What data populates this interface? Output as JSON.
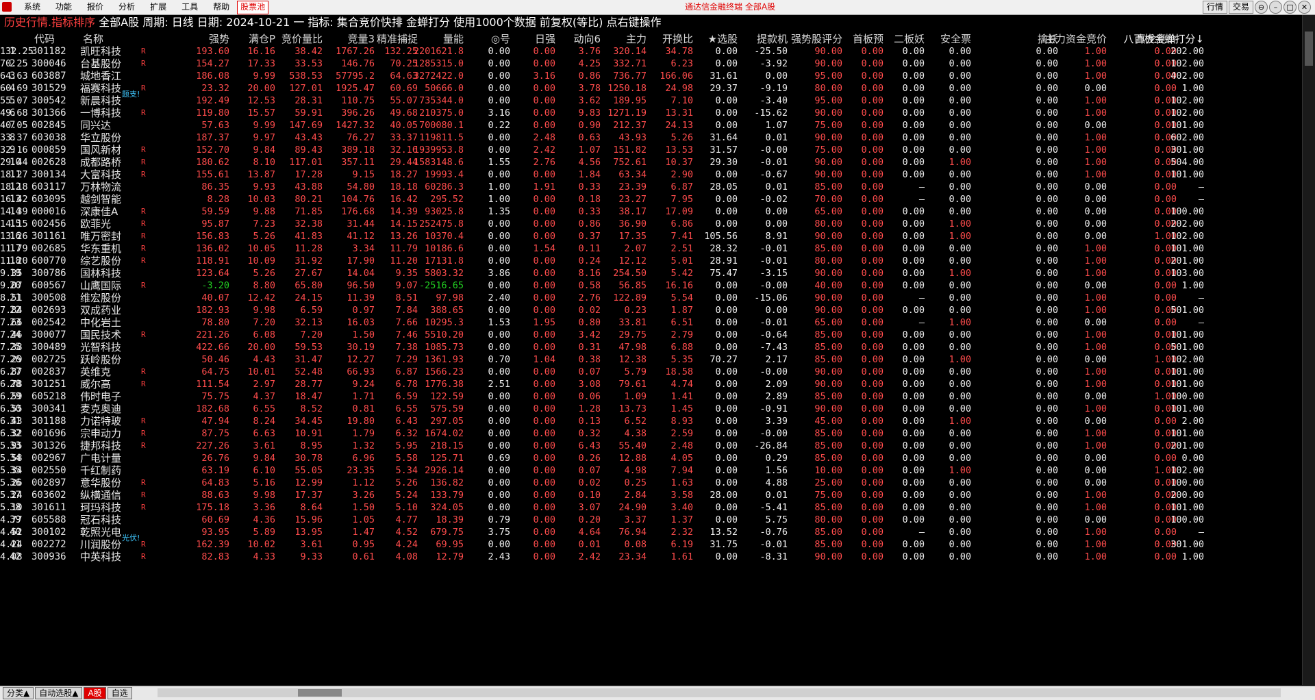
{
  "menubar": {
    "items": [
      "系统",
      "功能",
      "报价",
      "分析",
      "扩展",
      "工具",
      "帮助"
    ],
    "highlight": "股票池",
    "center": "通达信金融终端  全部A股",
    "buttons": [
      "行情",
      "交易"
    ],
    "window_buttons": [
      "⊖",
      "–",
      "□",
      "✕"
    ]
  },
  "titlebar": {
    "view": "历史行情.指标排序",
    "info": "全部A股 周期: 日线 日期: 2024-10-21 一 指标: 集合竞价快排 金蝉打分  使用1000个数据 前复权(等比) 点右键操作"
  },
  "columns": [
    "",
    "代码",
    "名称",
    "强势",
    "满仓P",
    "竞价量比",
    "竞量3",
    "精准捕捉",
    "量能",
    "◎号",
    "日强",
    "动向6",
    "主力",
    "开换比",
    "★选股",
    "提款机",
    "强势股评分",
    "首板预",
    "二板妖",
    "安全票",
    "擒妖",
    "主力资金竞价",
    "真龙竞价",
    "八百板金蝉打分↓"
  ],
  "rows": [
    [
      "1",
      "301182",
      "凯旺科技",
      "R",
      "193.60",
      "16.16",
      "38.42",
      "1767.26",
      "132.25",
      "2201621.8",
      "0.00",
      "0.00",
      "3.76",
      "320.14",
      "34.78",
      "0.00",
      "-25.50",
      "90.00",
      "0.00",
      "0.00",
      "0.00",
      "0.00",
      "1.00",
      "0.00",
      "202.00",
      "132.25"
    ],
    [
      "2",
      "300046",
      "台基股份",
      "R",
      "154.27",
      "17.33",
      "33.53",
      "146.76",
      "70.25",
      "1285315.0",
      "0.00",
      "0.00",
      "4.25",
      "332.71",
      "6.23",
      "0.00",
      "-3.92",
      "90.00",
      "0.00",
      "0.00",
      "0.00",
      "0.00",
      "1.00",
      "0.00",
      "102.00",
      "70.25"
    ],
    [
      "3",
      "603887",
      "城地香江",
      "",
      "186.08",
      "9.99",
      "538.53",
      "57795.2",
      "64.63",
      "3272422.0",
      "0.00",
      "3.16",
      "0.86",
      "736.77",
      "166.06",
      "31.61",
      "0.00",
      "95.00",
      "0.00",
      "0.00",
      "0.00",
      "0.00",
      "1.00",
      "0.00",
      "402.00",
      "64.63"
    ],
    [
      "4",
      "301529",
      "福赛科技",
      "R",
      "23.32",
      "20.00",
      "127.01",
      "1925.47",
      "60.69",
      "50666.0",
      "0.00",
      "0.00",
      "3.78",
      "1250.18",
      "24.98",
      "29.37",
      "-9.19",
      "80.00",
      "0.00",
      "0.00",
      "0.00",
      "0.00",
      "0.00",
      "0.00",
      "1.00",
      "60.69"
    ],
    [
      "5",
      "300542",
      "新晨科技",
      "",
      "192.49",
      "12.53",
      "28.31",
      "110.75",
      "55.07",
      "735344.0",
      "0.00",
      "0.00",
      "3.62",
      "189.95",
      "7.10",
      "0.00",
      "-3.40",
      "95.00",
      "0.00",
      "0.00",
      "0.00",
      "0.00",
      "1.00",
      "0.00",
      "102.00",
      "55.07"
    ],
    [
      "6",
      "301366",
      "一博科技",
      "R",
      "119.80",
      "15.57",
      "59.91",
      "396.26",
      "49.68",
      "210375.0",
      "3.16",
      "0.00",
      "9.83",
      "1271.19",
      "13.31",
      "0.00",
      "-15.62",
      "90.00",
      "0.00",
      "0.00",
      "0.00",
      "0.00",
      "1.00",
      "0.00",
      "102.00",
      "49.68"
    ],
    [
      "7",
      "002845",
      "同兴达",
      "",
      "57.63",
      "9.99",
      "147.69",
      "1427.32",
      "40.05",
      "700080.1",
      "0.22",
      "0.00",
      "0.90",
      "212.37",
      "24.13",
      "0.00",
      "1.07",
      "75.00",
      "0.00",
      "0.00",
      "0.00",
      "0.00",
      "0.00",
      "0.00",
      "101.00",
      "40.05"
    ],
    [
      "8",
      "603038",
      "华立股份",
      "",
      "187.37",
      "9.97",
      "43.43",
      "76.27",
      "33.37",
      "119811.5",
      "0.00",
      "2.48",
      "0.63",
      "43.93",
      "5.26",
      "31.64",
      "0.01",
      "90.00",
      "0.00",
      "0.00",
      "0.00",
      "0.00",
      "1.00",
      "0.00",
      "602.00",
      "33.37"
    ],
    [
      "9",
      "000859",
      "国风新材",
      "R",
      "152.70",
      "9.84",
      "89.43",
      "389.18",
      "32.16",
      "1939953.8",
      "0.00",
      "2.42",
      "1.07",
      "151.82",
      "13.53",
      "31.57",
      "-0.00",
      "75.00",
      "0.00",
      "0.00",
      "0.00",
      "0.00",
      "1.00",
      "0.00",
      "301.00",
      "32.16"
    ],
    [
      "10",
      "002628",
      "成都路桥",
      "R",
      "180.62",
      "8.10",
      "117.01",
      "357.11",
      "29.44",
      "1583148.6",
      "1.55",
      "2.76",
      "4.56",
      "752.61",
      "10.37",
      "29.30",
      "-0.01",
      "90.00",
      "0.00",
      "0.00",
      "1.00",
      "0.00",
      "1.00",
      "0.00",
      "504.00",
      "29.44"
    ],
    [
      "11",
      "300134",
      "大富科技",
      "R",
      "155.61",
      "13.87",
      "17.28",
      "9.15",
      "18.27",
      "19993.4",
      "0.00",
      "0.00",
      "1.84",
      "63.34",
      "2.90",
      "0.00",
      "-0.67",
      "90.00",
      "0.00",
      "0.00",
      "0.00",
      "0.00",
      "1.00",
      "0.00",
      "101.00",
      "18.27"
    ],
    [
      "12",
      "603117",
      "万林物流",
      "",
      "86.35",
      "9.93",
      "43.88",
      "54.80",
      "18.18",
      "60286.3",
      "1.00",
      "1.91",
      "0.33",
      "23.39",
      "6.87",
      "28.05",
      "0.01",
      "85.00",
      "0.00",
      "–",
      "0.00",
      "0.00",
      "0.00",
      "0.00",
      "–",
      "18.18"
    ],
    [
      "13",
      "603095",
      "越剑智能",
      "",
      "8.28",
      "10.03",
      "80.21",
      "104.76",
      "16.42",
      "295.52",
      "1.00",
      "0.00",
      "0.18",
      "23.27",
      "7.95",
      "0.00",
      "-0.02",
      "70.00",
      "0.00",
      "–",
      "0.00",
      "0.00",
      "0.00",
      "0.00",
      "–",
      "16.42"
    ],
    [
      "14",
      "000016",
      "深康佳A",
      "R",
      "59.59",
      "9.88",
      "71.85",
      "176.68",
      "14.39",
      "93025.8",
      "1.35",
      "0.00",
      "0.33",
      "38.17",
      "17.09",
      "0.00",
      "0.00",
      "65.00",
      "0.00",
      "0.00",
      "0.00",
      "0.00",
      "0.00",
      "0.00",
      "100.00",
      "14.39"
    ],
    [
      "15",
      "002456",
      "欧菲光",
      "R",
      "95.87",
      "7.23",
      "32.38",
      "31.44",
      "14.15",
      "252475.8",
      "0.00",
      "0.00",
      "0.86",
      "36.90",
      "6.86",
      "0.00",
      "0.00",
      "80.00",
      "0.00",
      "0.00",
      "1.00",
      "0.00",
      "0.00",
      "0.00",
      "202.00",
      "14.15"
    ],
    [
      "16",
      "301161",
      "唯万密封",
      "R",
      "156.83",
      "5.26",
      "41.83",
      "41.12",
      "13.26",
      "10370.4",
      "0.00",
      "0.00",
      "0.37",
      "17.35",
      "7.41",
      "105.56",
      "8.91",
      "90.00",
      "0.00",
      "0.00",
      "1.00",
      "0.00",
      "0.00",
      "1.00",
      "102.00",
      "13.26"
    ],
    [
      "17",
      "002685",
      "华东重机",
      "R",
      "136.02",
      "10.05",
      "11.28",
      "3.34",
      "11.79",
      "10186.6",
      "0.00",
      "1.54",
      "0.11",
      "2.07",
      "2.51",
      "28.32",
      "-0.01",
      "85.00",
      "0.00",
      "0.00",
      "0.00",
      "0.00",
      "1.00",
      "0.00",
      "101.00",
      "11.79"
    ],
    [
      "18",
      "600770",
      "综艺股份",
      "R",
      "118.91",
      "10.09",
      "31.92",
      "17.90",
      "11.20",
      "17131.8",
      "0.00",
      "0.00",
      "0.24",
      "12.12",
      "5.01",
      "28.91",
      "-0.01",
      "80.00",
      "0.00",
      "0.00",
      "0.00",
      "0.00",
      "1.00",
      "0.00",
      "201.00",
      "11.20"
    ],
    [
      "19",
      "300786",
      "国林科技",
      "",
      "123.64",
      "5.26",
      "27.67",
      "14.04",
      "9.35",
      "5803.32",
      "3.86",
      "0.00",
      "8.16",
      "254.50",
      "5.42",
      "75.47",
      "-3.15",
      "90.00",
      "0.00",
      "0.00",
      "1.00",
      "0.00",
      "1.00",
      "0.00",
      "103.00",
      "9.35"
    ],
    [
      "20",
      "600567",
      "山鹰国际",
      "R",
      "-3.20",
      "8.80",
      "65.80",
      "96.50",
      "9.07",
      "-2516.65",
      "0.00",
      "0.00",
      "0.58",
      "56.85",
      "16.16",
      "0.00",
      "-0.00",
      "40.00",
      "0.00",
      "0.00",
      "0.00",
      "0.00",
      "0.00",
      "0.00",
      "1.00",
      "9.07"
    ],
    [
      "21",
      "300508",
      "维宏股份",
      "",
      "40.07",
      "12.42",
      "24.15",
      "11.39",
      "8.51",
      "97.98",
      "2.40",
      "0.00",
      "2.76",
      "122.89",
      "5.54",
      "0.00",
      "-15.06",
      "90.00",
      "0.00",
      "–",
      "0.00",
      "0.00",
      "1.00",
      "0.00",
      "–",
      "8.51"
    ],
    [
      "22",
      "002693",
      "双成药业",
      "",
      "182.93",
      "9.98",
      "6.59",
      "0.97",
      "7.84",
      "388.65",
      "0.00",
      "0.00",
      "0.02",
      "0.23",
      "1.87",
      "0.00",
      "0.00",
      "90.00",
      "0.00",
      "0.00",
      "0.00",
      "0.00",
      "1.00",
      "0.00",
      "501.00",
      "7.84"
    ],
    [
      "23",
      "002542",
      "中化岩土",
      "",
      "78.80",
      "7.20",
      "32.13",
      "16.03",
      "7.66",
      "10295.3",
      "1.53",
      "1.95",
      "0.80",
      "33.81",
      "6.51",
      "0.00",
      "-0.01",
      "65.00",
      "0.00",
      "–",
      "1.00",
      "0.00",
      "0.00",
      "0.00",
      "–",
      "7.66"
    ],
    [
      "24",
      "300077",
      "国民技术",
      "R",
      "221.26",
      "6.08",
      "7.20",
      "1.50",
      "7.46",
      "5510.20",
      "0.00",
      "0.00",
      "3.42",
      "29.75",
      "2.79",
      "0.00",
      "-0.64",
      "85.00",
      "0.00",
      "0.00",
      "0.00",
      "0.00",
      "1.00",
      "0.00",
      "101.00",
      "7.46"
    ],
    [
      "25",
      "300489",
      "光智科技",
      "",
      "422.66",
      "20.00",
      "59.53",
      "30.19",
      "7.38",
      "1085.73",
      "0.00",
      "0.00",
      "0.31",
      "47.98",
      "6.88",
      "0.00",
      "-7.43",
      "85.00",
      "0.00",
      "0.00",
      "0.00",
      "0.00",
      "1.00",
      "0.00",
      "501.00",
      "7.38"
    ],
    [
      "26",
      "002725",
      "跃岭股份",
      "",
      "50.46",
      "4.43",
      "31.47",
      "12.27",
      "7.29",
      "1361.93",
      "0.70",
      "1.04",
      "0.38",
      "12.38",
      "5.35",
      "70.27",
      "2.17",
      "85.00",
      "0.00",
      "0.00",
      "1.00",
      "0.00",
      "0.00",
      "1.00",
      "102.00",
      "7.29"
    ],
    [
      "27",
      "002837",
      "英维克",
      "R",
      "64.75",
      "10.01",
      "52.48",
      "66.93",
      "6.87",
      "1566.23",
      "0.00",
      "0.00",
      "0.07",
      "5.79",
      "18.58",
      "0.00",
      "-0.00",
      "90.00",
      "0.00",
      "0.00",
      "0.00",
      "0.00",
      "1.00",
      "0.00",
      "101.00",
      "6.87"
    ],
    [
      "28",
      "301251",
      "威尔高",
      "R",
      "111.54",
      "2.97",
      "28.77",
      "9.24",
      "6.78",
      "1776.38",
      "2.51",
      "0.00",
      "3.08",
      "79.61",
      "4.74",
      "0.00",
      "2.09",
      "90.00",
      "0.00",
      "0.00",
      "0.00",
      "0.00",
      "1.00",
      "0.00",
      "101.00",
      "6.78"
    ],
    [
      "29",
      "605218",
      "伟时电子",
      "",
      "75.75",
      "4.37",
      "18.47",
      "1.71",
      "6.59",
      "122.59",
      "0.00",
      "0.00",
      "0.06",
      "1.09",
      "1.41",
      "0.00",
      "2.89",
      "85.00",
      "0.00",
      "0.00",
      "0.00",
      "0.00",
      "0.00",
      "1.00",
      "100.00",
      "6.59"
    ],
    [
      "30",
      "300341",
      "麦克奥迪",
      "",
      "182.68",
      "6.55",
      "8.52",
      "0.81",
      "6.55",
      "575.59",
      "0.00",
      "0.00",
      "1.28",
      "13.73",
      "1.45",
      "0.00",
      "-0.91",
      "90.00",
      "0.00",
      "0.00",
      "0.00",
      "0.00",
      "1.00",
      "0.00",
      "101.00",
      "6.55"
    ],
    [
      "31",
      "301188",
      "力诺特玻",
      "R",
      "47.94",
      "8.24",
      "34.45",
      "19.80",
      "6.43",
      "297.05",
      "0.00",
      "0.00",
      "0.13",
      "6.52",
      "8.93",
      "0.00",
      "3.39",
      "45.00",
      "0.00",
      "0.00",
      "1.00",
      "0.00",
      "0.00",
      "0.00",
      "2.00",
      "6.43"
    ],
    [
      "32",
      "001696",
      "宗申动力",
      "R",
      "87.75",
      "6.63",
      "10.91",
      "1.79",
      "6.32",
      "1674.02",
      "0.00",
      "0.00",
      "0.32",
      "4.38",
      "2.59",
      "0.00",
      "-0.00",
      "85.00",
      "0.00",
      "0.00",
      "0.00",
      "0.00",
      "1.00",
      "0.00",
      "101.00",
      "6.32"
    ],
    [
      "33",
      "301326",
      "捷邦科技",
      "R",
      "227.26",
      "3.61",
      "8.95",
      "1.32",
      "5.95",
      "218.15",
      "0.00",
      "0.00",
      "6.43",
      "55.40",
      "2.48",
      "0.00",
      "-26.84",
      "85.00",
      "0.00",
      "0.00",
      "0.00",
      "0.00",
      "1.00",
      "0.00",
      "201.00",
      "5.95"
    ],
    [
      "34",
      "002967",
      "广电计量",
      "",
      "26.76",
      "9.84",
      "30.78",
      "6.96",
      "5.58",
      "125.71",
      "0.69",
      "0.00",
      "0.26",
      "12.88",
      "4.05",
      "0.00",
      "0.29",
      "85.00",
      "0.00",
      "0.00",
      "0.00",
      "0.00",
      "0.00",
      "0.00",
      "0.00",
      "5.58"
    ],
    [
      "35",
      "002550",
      "千红制药",
      "",
      "63.19",
      "6.10",
      "55.05",
      "23.35",
      "5.34",
      "2926.14",
      "0.00",
      "0.00",
      "0.07",
      "4.98",
      "7.94",
      "0.00",
      "1.56",
      "10.00",
      "0.00",
      "0.00",
      "1.00",
      "0.00",
      "0.00",
      "1.00",
      "102.00",
      "5.34"
    ],
    [
      "36",
      "002897",
      "意华股份",
      "R",
      "64.83",
      "5.16",
      "12.99",
      "1.12",
      "5.26",
      "136.82",
      "0.00",
      "0.00",
      "0.02",
      "0.25",
      "1.63",
      "0.00",
      "4.88",
      "25.00",
      "0.00",
      "0.00",
      "0.00",
      "0.00",
      "0.00",
      "0.00",
      "100.00",
      "5.26"
    ],
    [
      "37",
      "603602",
      "纵横通信",
      "R",
      "88.63",
      "9.98",
      "17.37",
      "3.26",
      "5.24",
      "133.79",
      "0.00",
      "0.00",
      "0.10",
      "2.84",
      "3.58",
      "28.00",
      "0.01",
      "75.00",
      "0.00",
      "0.00",
      "0.00",
      "0.00",
      "1.00",
      "0.00",
      "200.00",
      "5.24"
    ],
    [
      "38",
      "301611",
      "珂玛科技",
      "R",
      "175.18",
      "3.36",
      "8.64",
      "1.50",
      "5.10",
      "324.05",
      "0.00",
      "0.00",
      "3.07",
      "24.90",
      "3.40",
      "0.00",
      "-5.41",
      "85.00",
      "0.00",
      "0.00",
      "0.00",
      "0.00",
      "1.00",
      "0.00",
      "101.00",
      "5.10"
    ],
    [
      "39",
      "605588",
      "冠石科技",
      "",
      "60.69",
      "4.36",
      "15.96",
      "1.05",
      "4.77",
      "18.39",
      "0.79",
      "0.00",
      "0.20",
      "3.37",
      "1.37",
      "0.00",
      "5.75",
      "80.00",
      "0.00",
      "0.00",
      "0.00",
      "0.00",
      "0.00",
      "0.00",
      "100.00",
      "4.77"
    ],
    [
      "40",
      "300102",
      "乾照光电",
      "",
      "93.95",
      "5.89",
      "13.95",
      "1.47",
      "4.52",
      "679.75",
      "3.75",
      "0.00",
      "4.64",
      "76.94",
      "2.32",
      "13.52",
      "-0.76",
      "85.00",
      "0.00",
      "–",
      "0.00",
      "0.00",
      "1.00",
      "0.00",
      "–",
      "4.52"
    ],
    [
      "41",
      "002272",
      "川润股份",
      "R",
      "162.39",
      "10.02",
      "3.61",
      "0.95",
      "4.24",
      "69.95",
      "0.00",
      "0.00",
      "0.01",
      "0.08",
      "6.19",
      "31.75",
      "-0.01",
      "85.00",
      "0.00",
      "0.00",
      "0.00",
      "0.00",
      "1.00",
      "0.00",
      "301.00",
      "4.24"
    ],
    [
      "42",
      "300936",
      "中英科技",
      "R",
      "82.83",
      "4.33",
      "9.33",
      "0.61",
      "4.08",
      "12.79",
      "2.43",
      "0.00",
      "2.42",
      "23.34",
      "1.61",
      "0.00",
      "-8.31",
      "90.00",
      "0.00",
      "0.00",
      "0.00",
      "0.00",
      "1.00",
      "0.00",
      "1.00",
      "4.08"
    ]
  ],
  "row_tags": {
    "5": "题支!",
    "41": "光伏!"
  },
  "bottom_tabs": [
    "分类▲",
    "自动选股▲",
    "A股",
    "自选"
  ],
  "bottom_active": "A股",
  "colors": {
    "up": "#ff4c4c",
    "down": "#22d022",
    "neutral": "#f0f0f0",
    "background": "#000000"
  }
}
